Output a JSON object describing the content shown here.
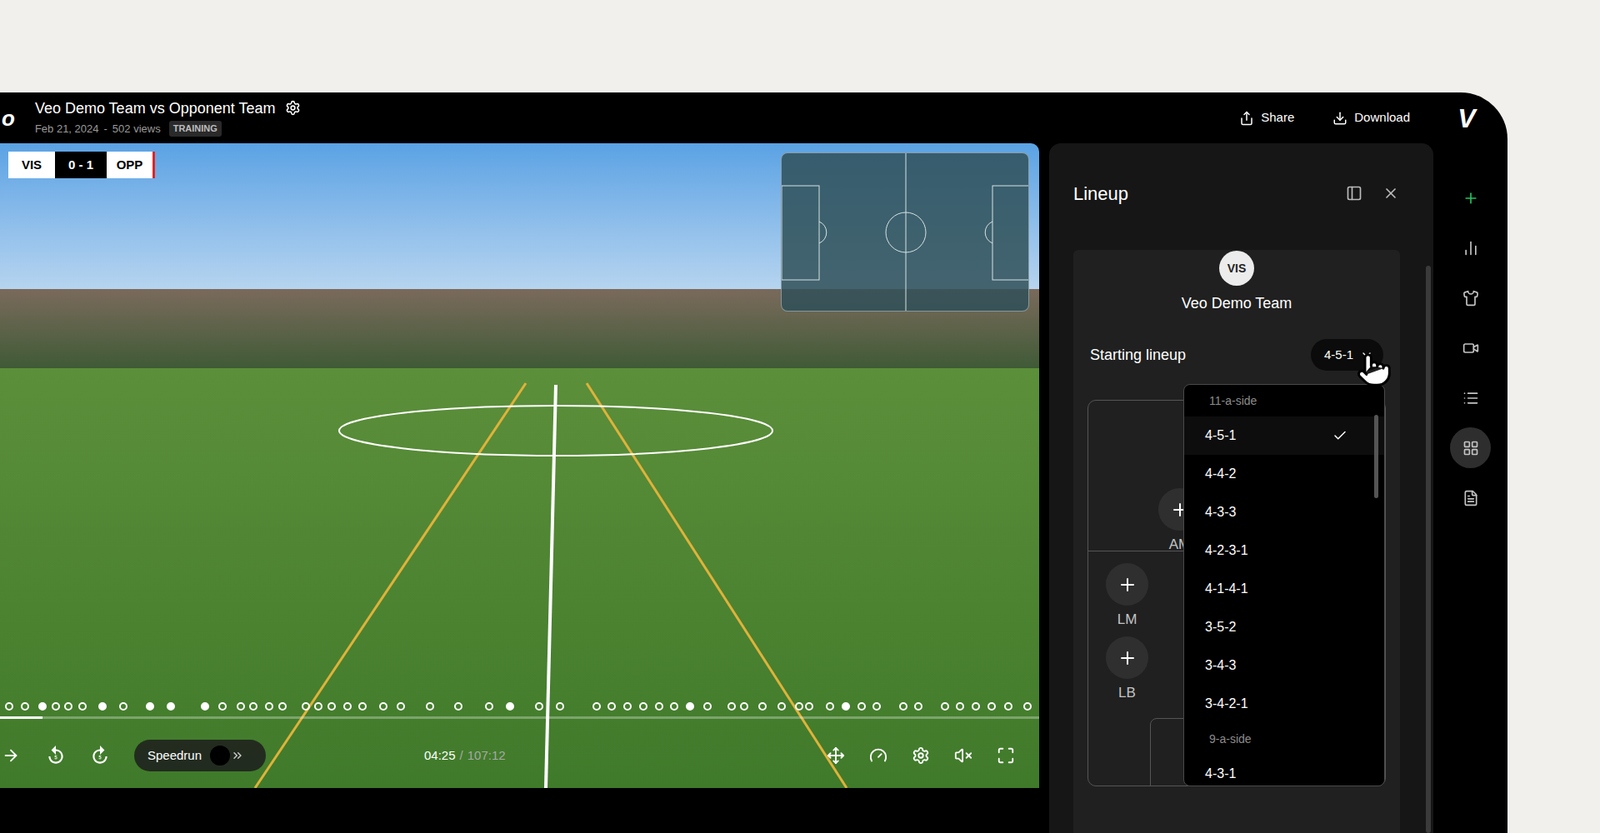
{
  "logo": "o",
  "header": {
    "title": "Veo Demo Team vs Opponent Team",
    "date": "Feb 21, 2024",
    "separator": "-",
    "views": "502 views",
    "badge": "TRAINING",
    "actions": [
      "Share",
      "Download"
    ],
    "brand": "V"
  },
  "video": {
    "score": {
      "home": "VIS",
      "result": "0 - 1",
      "away": "OPP"
    },
    "timeline": {
      "level": 0.041,
      "events": [
        {
          "at": 0.005,
          "filled": false
        },
        {
          "at": 0.02,
          "filled": false
        },
        {
          "at": 0.037,
          "filled": true
        },
        {
          "at": 0.05,
          "filled": false
        },
        {
          "at": 0.062,
          "filled": false
        },
        {
          "at": 0.075,
          "filled": false
        },
        {
          "at": 0.095,
          "filled": true
        },
        {
          "at": 0.115,
          "filled": false
        },
        {
          "at": 0.14,
          "filled": true
        },
        {
          "at": 0.16,
          "filled": true
        },
        {
          "at": 0.193,
          "filled": true
        },
        {
          "at": 0.21,
          "filled": false
        },
        {
          "at": 0.228,
          "filled": false
        },
        {
          "at": 0.24,
          "filled": false
        },
        {
          "at": 0.255,
          "filled": false
        },
        {
          "at": 0.268,
          "filled": false
        },
        {
          "at": 0.29,
          "filled": false
        },
        {
          "at": 0.302,
          "filled": false
        },
        {
          "at": 0.315,
          "filled": false
        },
        {
          "at": 0.33,
          "filled": false
        },
        {
          "at": 0.345,
          "filled": false
        },
        {
          "at": 0.365,
          "filled": false
        },
        {
          "at": 0.382,
          "filled": false
        },
        {
          "at": 0.41,
          "filled": false
        },
        {
          "at": 0.437,
          "filled": false
        },
        {
          "at": 0.467,
          "filled": false
        },
        {
          "at": 0.487,
          "filled": true
        },
        {
          "at": 0.515,
          "filled": false
        },
        {
          "at": 0.535,
          "filled": false
        },
        {
          "at": 0.57,
          "filled": false
        },
        {
          "at": 0.585,
          "filled": false
        },
        {
          "at": 0.6,
          "filled": false
        },
        {
          "at": 0.615,
          "filled": false
        },
        {
          "at": 0.63,
          "filled": false
        },
        {
          "at": 0.645,
          "filled": false
        },
        {
          "at": 0.66,
          "filled": true
        },
        {
          "at": 0.677,
          "filled": false
        },
        {
          "at": 0.7,
          "filled": false
        },
        {
          "at": 0.712,
          "filled": false
        },
        {
          "at": 0.73,
          "filled": false
        },
        {
          "at": 0.748,
          "filled": false
        },
        {
          "at": 0.765,
          "filled": false
        },
        {
          "at": 0.775,
          "filled": false
        },
        {
          "at": 0.795,
          "filled": false
        },
        {
          "at": 0.81,
          "filled": true
        },
        {
          "at": 0.825,
          "filled": false
        },
        {
          "at": 0.84,
          "filled": false
        },
        {
          "at": 0.865,
          "filled": false
        },
        {
          "at": 0.88,
          "filled": false
        },
        {
          "at": 0.905,
          "filled": false
        },
        {
          "at": 0.92,
          "filled": false
        },
        {
          "at": 0.935,
          "filled": false
        },
        {
          "at": 0.95,
          "filled": false
        },
        {
          "at": 0.966,
          "filled": false
        },
        {
          "at": 0.985,
          "filled": false
        }
      ]
    },
    "speedrun": {
      "label": "Speedrun",
      "on": false
    },
    "time": {
      "current": "04:25",
      "separator": "/",
      "total": "107:12"
    },
    "muted": true
  },
  "lineup_panel": {
    "title": "Lineup",
    "team": {
      "badge": "VIS",
      "name": "Veo Demo Team"
    },
    "formation_label": "Starting lineup",
    "formation": "4-5-1",
    "positions": [
      {
        "label": "AM"
      },
      {
        "label": "LM"
      },
      {
        "label": "LB"
      }
    ],
    "menu": {
      "open": true,
      "groups": [
        {
          "label": "11-a-side",
          "options": [
            {
              "label": "4-5-1",
              "selected": true
            },
            {
              "label": "4-4-2",
              "selected": false
            },
            {
              "label": "4-3-3",
              "selected": false
            },
            {
              "label": "4-2-3-1",
              "selected": false
            },
            {
              "label": "4-1-4-1",
              "selected": false
            },
            {
              "label": "3-5-2",
              "selected": false
            },
            {
              "label": "3-4-3",
              "selected": false
            },
            {
              "label": "3-4-2-1",
              "selected": false
            }
          ]
        },
        {
          "label": "9-a-side",
          "options": [
            {
              "label": "4-3-1",
              "selected": false
            }
          ]
        }
      ]
    }
  },
  "rail": {
    "items": [
      {
        "kind": "add",
        "selected": false
      },
      {
        "kind": "stats",
        "selected": false
      },
      {
        "kind": "kit",
        "selected": false
      },
      {
        "kind": "video",
        "selected": false
      },
      {
        "kind": "list",
        "selected": false
      },
      {
        "kind": "lineup",
        "selected": true
      },
      {
        "kind": "notes",
        "selected": false
      }
    ]
  }
}
